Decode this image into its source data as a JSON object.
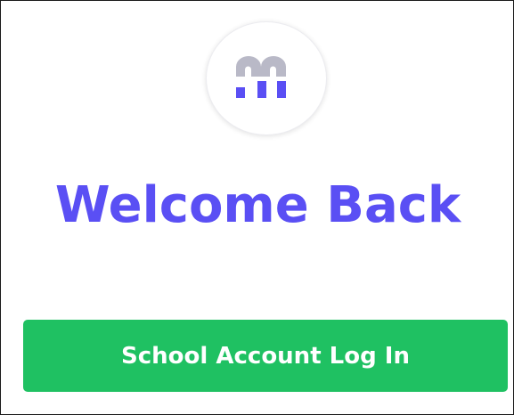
{
  "heading": {
    "text": "Welcome Back"
  },
  "login_button": {
    "label": "School Account Log In"
  },
  "logo": {
    "icon": "brand-m-logo-icon",
    "top_color": "#b9b9c7",
    "bottom_color": "#5a4ff4"
  },
  "colors": {
    "heading": "#5a4ff4",
    "button_bg": "#1fc162",
    "button_text": "#ffffff"
  }
}
